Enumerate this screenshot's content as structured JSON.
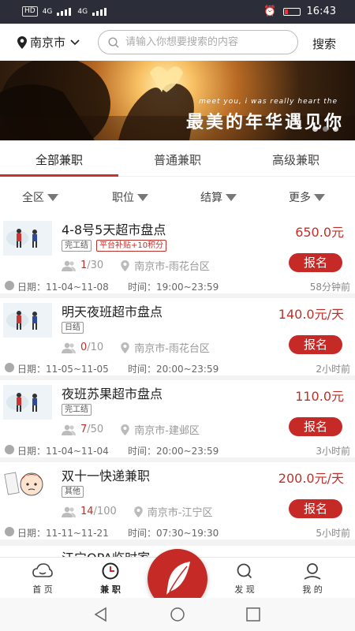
{
  "statusbar": {
    "net1": "4G",
    "net2": "4G",
    "time": "16:43"
  },
  "header": {
    "city": "南京市",
    "search_placeholder": "请输入你想要搜索的内容",
    "search_button": "搜索"
  },
  "banner": {
    "small_text": "meet you, i was really heart the",
    "title": "最美的年华遇见你"
  },
  "tabs": [
    {
      "label": "全部兼职",
      "active": true
    },
    {
      "label": "普通兼职",
      "active": false
    },
    {
      "label": "高级兼职",
      "active": false
    }
  ],
  "filters": [
    "全区",
    "职位",
    "结算",
    "更多"
  ],
  "jobs": [
    {
      "title": "4-8号5天超市盘点",
      "price": "650.0元",
      "tags": [
        "完工结",
        "平台补贴+10积分"
      ],
      "enrolled": "1",
      "capacity": "/30",
      "location": "南京市-雨花台区",
      "apply": "报名",
      "date": "日期：11-04~11-08",
      "time": "时间：19:00~23:59",
      "ago": "58分钟前"
    },
    {
      "title": "明天夜班超市盘点",
      "price": "140.0元/天",
      "tags": [
        "日结"
      ],
      "enrolled": "0",
      "capacity": "/10",
      "location": "南京市-雨花台区",
      "apply": "报名",
      "date": "日期：11-05~11-05",
      "time": "时间：20:00~23:59",
      "ago": "2小时前"
    },
    {
      "title": "夜班苏果超市盘点",
      "price": "110.0元",
      "tags": [
        "完工结"
      ],
      "enrolled": "7",
      "capacity": "/50",
      "location": "南京市-建邺区",
      "apply": "报名",
      "date": "日期：11-04~11-04",
      "time": "时间：20:00~23:59",
      "ago": "3小时前"
    },
    {
      "title": "双十一快递兼职",
      "price": "200.0元/天",
      "tags": [
        "其他"
      ],
      "enrolled": "14",
      "capacity": "/100",
      "location": "南京市-江宁区",
      "apply": "报名",
      "date": "日期：11-11~11-21",
      "time": "时间：07:30~19:30",
      "ago": "5小时前"
    }
  ],
  "partial_job_title": "江宁OPA临时家",
  "bottom_nav": [
    {
      "label": "首 页",
      "icon": "home-cloud-icon"
    },
    {
      "label": "兼 职",
      "icon": "clock-icon",
      "active": true
    },
    {
      "label": "feather-icon",
      "icon": "feather-icon"
    },
    {
      "label": "发 现",
      "icon": "search-icon"
    },
    {
      "label": "我 的",
      "icon": "user-icon"
    }
  ],
  "colors": {
    "accent": "#c52a26",
    "statusbar": "#2b2d38"
  }
}
